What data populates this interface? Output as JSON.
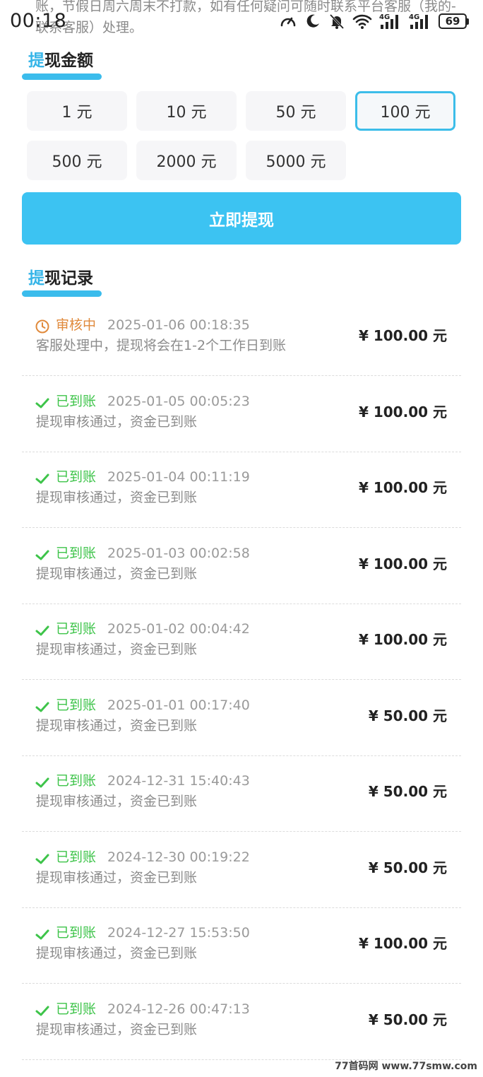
{
  "status_bar": {
    "time": "00:18",
    "battery": "69",
    "signal_1": "4G",
    "signal_2": "4G"
  },
  "notice_text": "账，节假日周六周末不打款，如有任何疑问可随时联系平台客服（我的-联系客服）处理。",
  "withdraw_amount": {
    "title_accent": "提",
    "title_rest": "现金额",
    "options": [
      "1 元",
      "10 元",
      "50 元",
      "100 元",
      "500 元",
      "2000 元",
      "5000 元"
    ],
    "selected_index": 3
  },
  "withdraw_button": "立即提现",
  "records_section": {
    "title_accent": "提",
    "title_rest": "现记录"
  },
  "records": [
    {
      "status": "审核中",
      "status_type": "pending",
      "time": "2025-01-06 00:18:35",
      "desc": "客服处理中，提现将会在1-2个工作日到账",
      "amount": "¥ 100.00 元"
    },
    {
      "status": "已到账",
      "status_type": "done",
      "time": "2025-01-05 00:05:23",
      "desc": "提现审核通过，资金已到账",
      "amount": "¥ 100.00 元"
    },
    {
      "status": "已到账",
      "status_type": "done",
      "time": "2025-01-04 00:11:19",
      "desc": "提现审核通过，资金已到账",
      "amount": "¥ 100.00 元"
    },
    {
      "status": "已到账",
      "status_type": "done",
      "time": "2025-01-03 00:02:58",
      "desc": "提现审核通过，资金已到账",
      "amount": "¥ 100.00 元"
    },
    {
      "status": "已到账",
      "status_type": "done",
      "time": "2025-01-02 00:04:42",
      "desc": "提现审核通过，资金已到账",
      "amount": "¥ 100.00 元"
    },
    {
      "status": "已到账",
      "status_type": "done",
      "time": "2025-01-01 00:17:40",
      "desc": "提现审核通过，资金已到账",
      "amount": "¥ 50.00 元"
    },
    {
      "status": "已到账",
      "status_type": "done",
      "time": "2024-12-31 15:40:43",
      "desc": "提现审核通过，资金已到账",
      "amount": "¥ 50.00 元"
    },
    {
      "status": "已到账",
      "status_type": "done",
      "time": "2024-12-30 00:19:22",
      "desc": "提现审核通过，资金已到账",
      "amount": "¥ 50.00 元"
    },
    {
      "status": "已到账",
      "status_type": "done",
      "time": "2024-12-27 15:53:50",
      "desc": "提现审核通过，资金已到账",
      "amount": "¥ 100.00 元"
    },
    {
      "status": "已到账",
      "status_type": "done",
      "time": "2024-12-26 00:47:13",
      "desc": "提现审核通过，资金已到账",
      "amount": "¥ 50.00 元"
    }
  ],
  "watermark": "77首码网 www.77smw.com",
  "colors": {
    "accent": "#3cc3f2",
    "done": "#3ec44a",
    "pending": "#e08a3c"
  }
}
